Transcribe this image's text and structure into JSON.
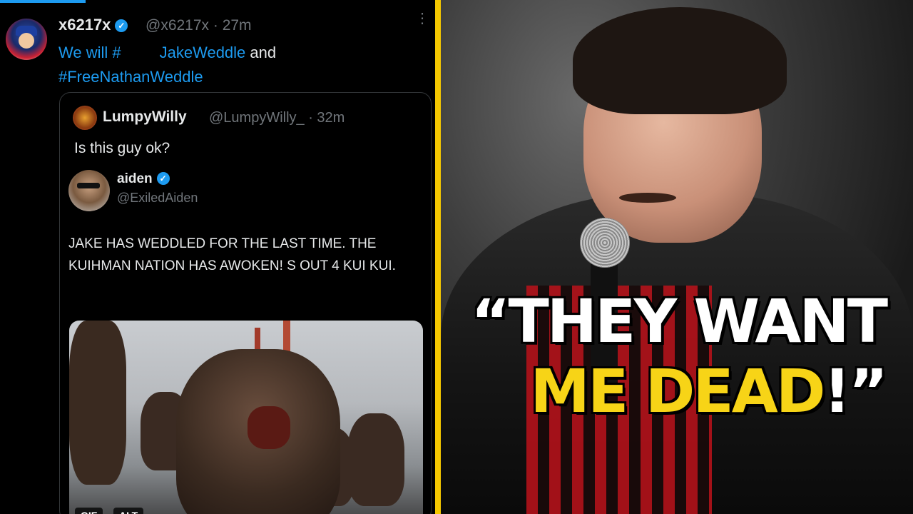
{
  "tweet": {
    "author_name": "x6217x",
    "handle_time": "@x6217x · 27m",
    "text_prefix": "We will #",
    "text_mid": "JakeWeddle",
    "text_and": " and",
    "hashtag2": "#FreeNathanWeddle",
    "more_label": "⋮"
  },
  "quote": {
    "author_name": "LumpyWilly",
    "handle_time": "@LumpyWilly_ · 32m",
    "text": "Is this guy ok?"
  },
  "embedded": {
    "author_name": "aiden",
    "handle": "@ExiledAiden",
    "body": "JAKE HAS WEDDLED FOR THE LAST TIME. THE KUIHMAN NATION HAS AWOKEN!            S OUT 4 KUI KUI.",
    "gif_badge": "GIF",
    "alt_badge": "ALT"
  },
  "caption": {
    "line1": "“THEY WANT",
    "line2": "ME DEAD",
    "line2_end": "!”"
  },
  "colors": {
    "divider": "#f5c800",
    "caption_yellow": "#f7d417",
    "link_blue": "#1d9bf0"
  }
}
